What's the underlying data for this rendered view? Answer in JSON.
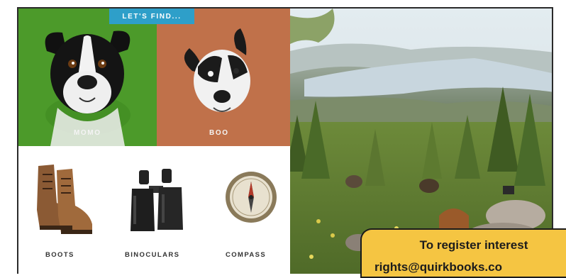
{
  "header": {
    "badge": "LET'S FIND..."
  },
  "dogs": [
    {
      "name": "MOMO",
      "background": "#4c9a2a"
    },
    {
      "name": "BOO",
      "background": "#c0714a"
    }
  ],
  "items": [
    {
      "label": "BOOTS",
      "icon": "boots-icon"
    },
    {
      "label": "BINOCULARS",
      "icon": "binoculars-icon"
    },
    {
      "label": "COMPASS",
      "icon": "compass-icon"
    }
  ],
  "banner": {
    "line1": "To register interest",
    "line2": "rights@quirkbooks.co",
    "color": "#f5c542"
  }
}
